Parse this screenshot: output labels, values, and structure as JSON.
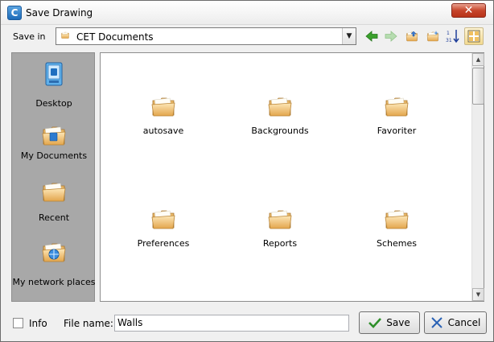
{
  "window": {
    "title": "Save Drawing",
    "app_icon": "cet-app-icon",
    "close_glyph": "✕"
  },
  "save_in": {
    "label": "Save in",
    "current_folder": "CET Documents",
    "toolbar": [
      {
        "name": "back-icon",
        "color": "#3aa02c"
      },
      {
        "name": "forward-icon",
        "color": "#b6dcb0"
      },
      {
        "name": "up-folder-icon"
      },
      {
        "name": "new-folder-icon"
      },
      {
        "name": "sort-icon"
      },
      {
        "name": "view-menu-icon"
      }
    ]
  },
  "places": [
    {
      "label": "Desktop",
      "icon": "desktop-icon"
    },
    {
      "label": "My Documents",
      "icon": "my-documents-icon"
    },
    {
      "label": "Recent",
      "icon": "recent-folder-icon"
    },
    {
      "label": "My network places",
      "icon": "network-places-icon"
    }
  ],
  "files": [
    {
      "label": "autosave",
      "icon": "folder-icon"
    },
    {
      "label": "Backgrounds",
      "icon": "folder-icon"
    },
    {
      "label": "Favoriter",
      "icon": "folder-icon"
    },
    {
      "label": "Preferences",
      "icon": "folder-icon"
    },
    {
      "label": "Reports",
      "icon": "folder-icon"
    },
    {
      "label": "Schemes",
      "icon": "folder-icon"
    }
  ],
  "footer": {
    "info_label": "Info",
    "info_checked": false,
    "file_name_label": "File name:",
    "file_name_value": "Walls",
    "save_label": "Save",
    "cancel_label": "Cancel"
  },
  "colors": {
    "folder_light": "#f9d89a",
    "folder_dark": "#d9a24a",
    "places_bg": "#a8a8a8",
    "close_red": "#c7452b"
  }
}
